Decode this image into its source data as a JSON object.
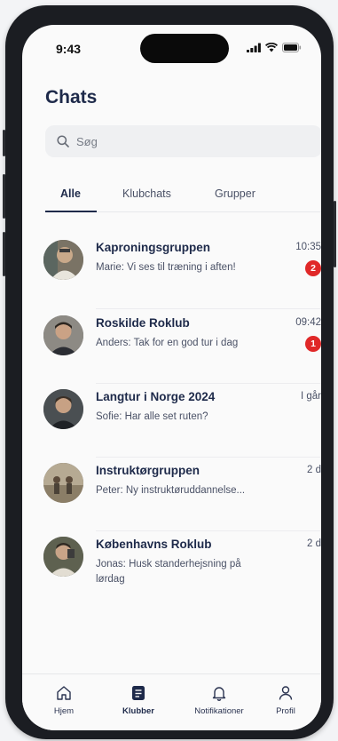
{
  "status": {
    "time": "9:43"
  },
  "header": {
    "title": "Chats"
  },
  "search": {
    "placeholder": "Søg"
  },
  "tabs": [
    {
      "label": "Alle",
      "active": true
    },
    {
      "label": "Klubchats",
      "active": false
    },
    {
      "label": "Grupper",
      "active": false
    }
  ],
  "chats": [
    {
      "name": "Kaproningsgruppen",
      "message": "Marie: Vi ses til træning i aften!",
      "time": "10:35",
      "unread": "2"
    },
    {
      "name": "Roskilde Roklub",
      "message": "Anders: Tak for en god tur i dag",
      "time": "09:42",
      "unread": "1"
    },
    {
      "name": "Langtur i Norge 2024",
      "message": "Sofie: Har alle set ruten?",
      "time": "I går",
      "unread": null
    },
    {
      "name": "Instruktørgruppen",
      "message": "Peter: Ny instruktøruddannelse...",
      "time": "2 d",
      "unread": null
    },
    {
      "name": "Københavns Roklub",
      "message": "Jonas: Husk standerhejsning på lørdag",
      "time": "2 d",
      "unread": null
    }
  ],
  "bottom_nav": [
    {
      "label": "Hjem",
      "icon": "home-icon",
      "active": false
    },
    {
      "label": "Klubber",
      "icon": "clubs-icon",
      "active": true
    },
    {
      "label": "Notifikationer",
      "icon": "bell-icon",
      "active": false
    },
    {
      "label": "Profil",
      "icon": "person-icon",
      "active": false
    }
  ],
  "colors": {
    "accent": "#1e2a4a",
    "badge": "#e02828",
    "background": "#fafafa"
  }
}
